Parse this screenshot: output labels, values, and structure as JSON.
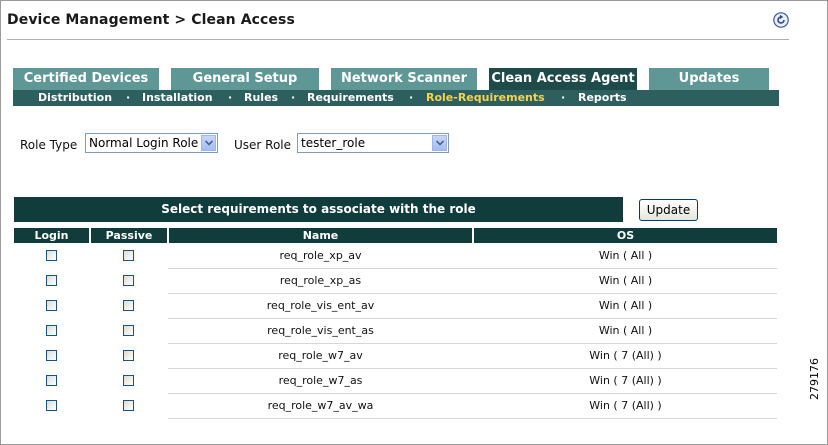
{
  "header": {
    "title": "Device Management > Clean Access",
    "refresh_icon": "refresh-icon"
  },
  "tabs": [
    {
      "label": "Certified Devices",
      "active": false
    },
    {
      "label": "General Setup",
      "active": false
    },
    {
      "label": "Network Scanner",
      "active": false
    },
    {
      "label": "Clean Access Agent",
      "active": true
    },
    {
      "label": "Updates",
      "active": false
    }
  ],
  "subnav": [
    {
      "label": "Distribution",
      "active": false
    },
    {
      "label": "Installation",
      "active": false
    },
    {
      "label": "Rules",
      "active": false
    },
    {
      "label": "Requirements",
      "active": false
    },
    {
      "label": "Role-Requirements",
      "active": true
    },
    {
      "label": "Reports",
      "active": false
    }
  ],
  "subnav_separator": "·",
  "filters": {
    "role_type_label": "Role Type",
    "role_type_value": "Normal Login Role",
    "user_role_label": "User Role",
    "user_role_value": "tester_role"
  },
  "banner": "Select requirements to associate with the role",
  "update_button": "Update",
  "table": {
    "columns": [
      "Login",
      "Passive",
      "Name",
      "OS"
    ],
    "rows": [
      {
        "name": "req_role_xp_av",
        "os": "Win ( All )",
        "login": false,
        "passive": false
      },
      {
        "name": "req_role_xp_as",
        "os": "Win ( All )",
        "login": false,
        "passive": false
      },
      {
        "name": "req_role_vis_ent_av",
        "os": "Win ( All )",
        "login": false,
        "passive": false
      },
      {
        "name": "req_role_vis_ent_as",
        "os": "Win ( All )",
        "login": false,
        "passive": false
      },
      {
        "name": "req_role_w7_av",
        "os": "Win ( 7 (All) )",
        "login": false,
        "passive": false
      },
      {
        "name": "req_role_w7_as",
        "os": "Win ( 7 (All) )",
        "login": false,
        "passive": false
      },
      {
        "name": "req_role_w7_av_wa",
        "os": "Win ( 7 (All) )",
        "login": false,
        "passive": false
      }
    ]
  },
  "figure_number": "279176",
  "colors": {
    "tab_inactive": "#5f9796",
    "tab_active": "#1e4a4a",
    "subnav_bg": "#2d5f5f",
    "subnav_active": "#f6d34a",
    "table_header_bg": "#103c3c"
  }
}
